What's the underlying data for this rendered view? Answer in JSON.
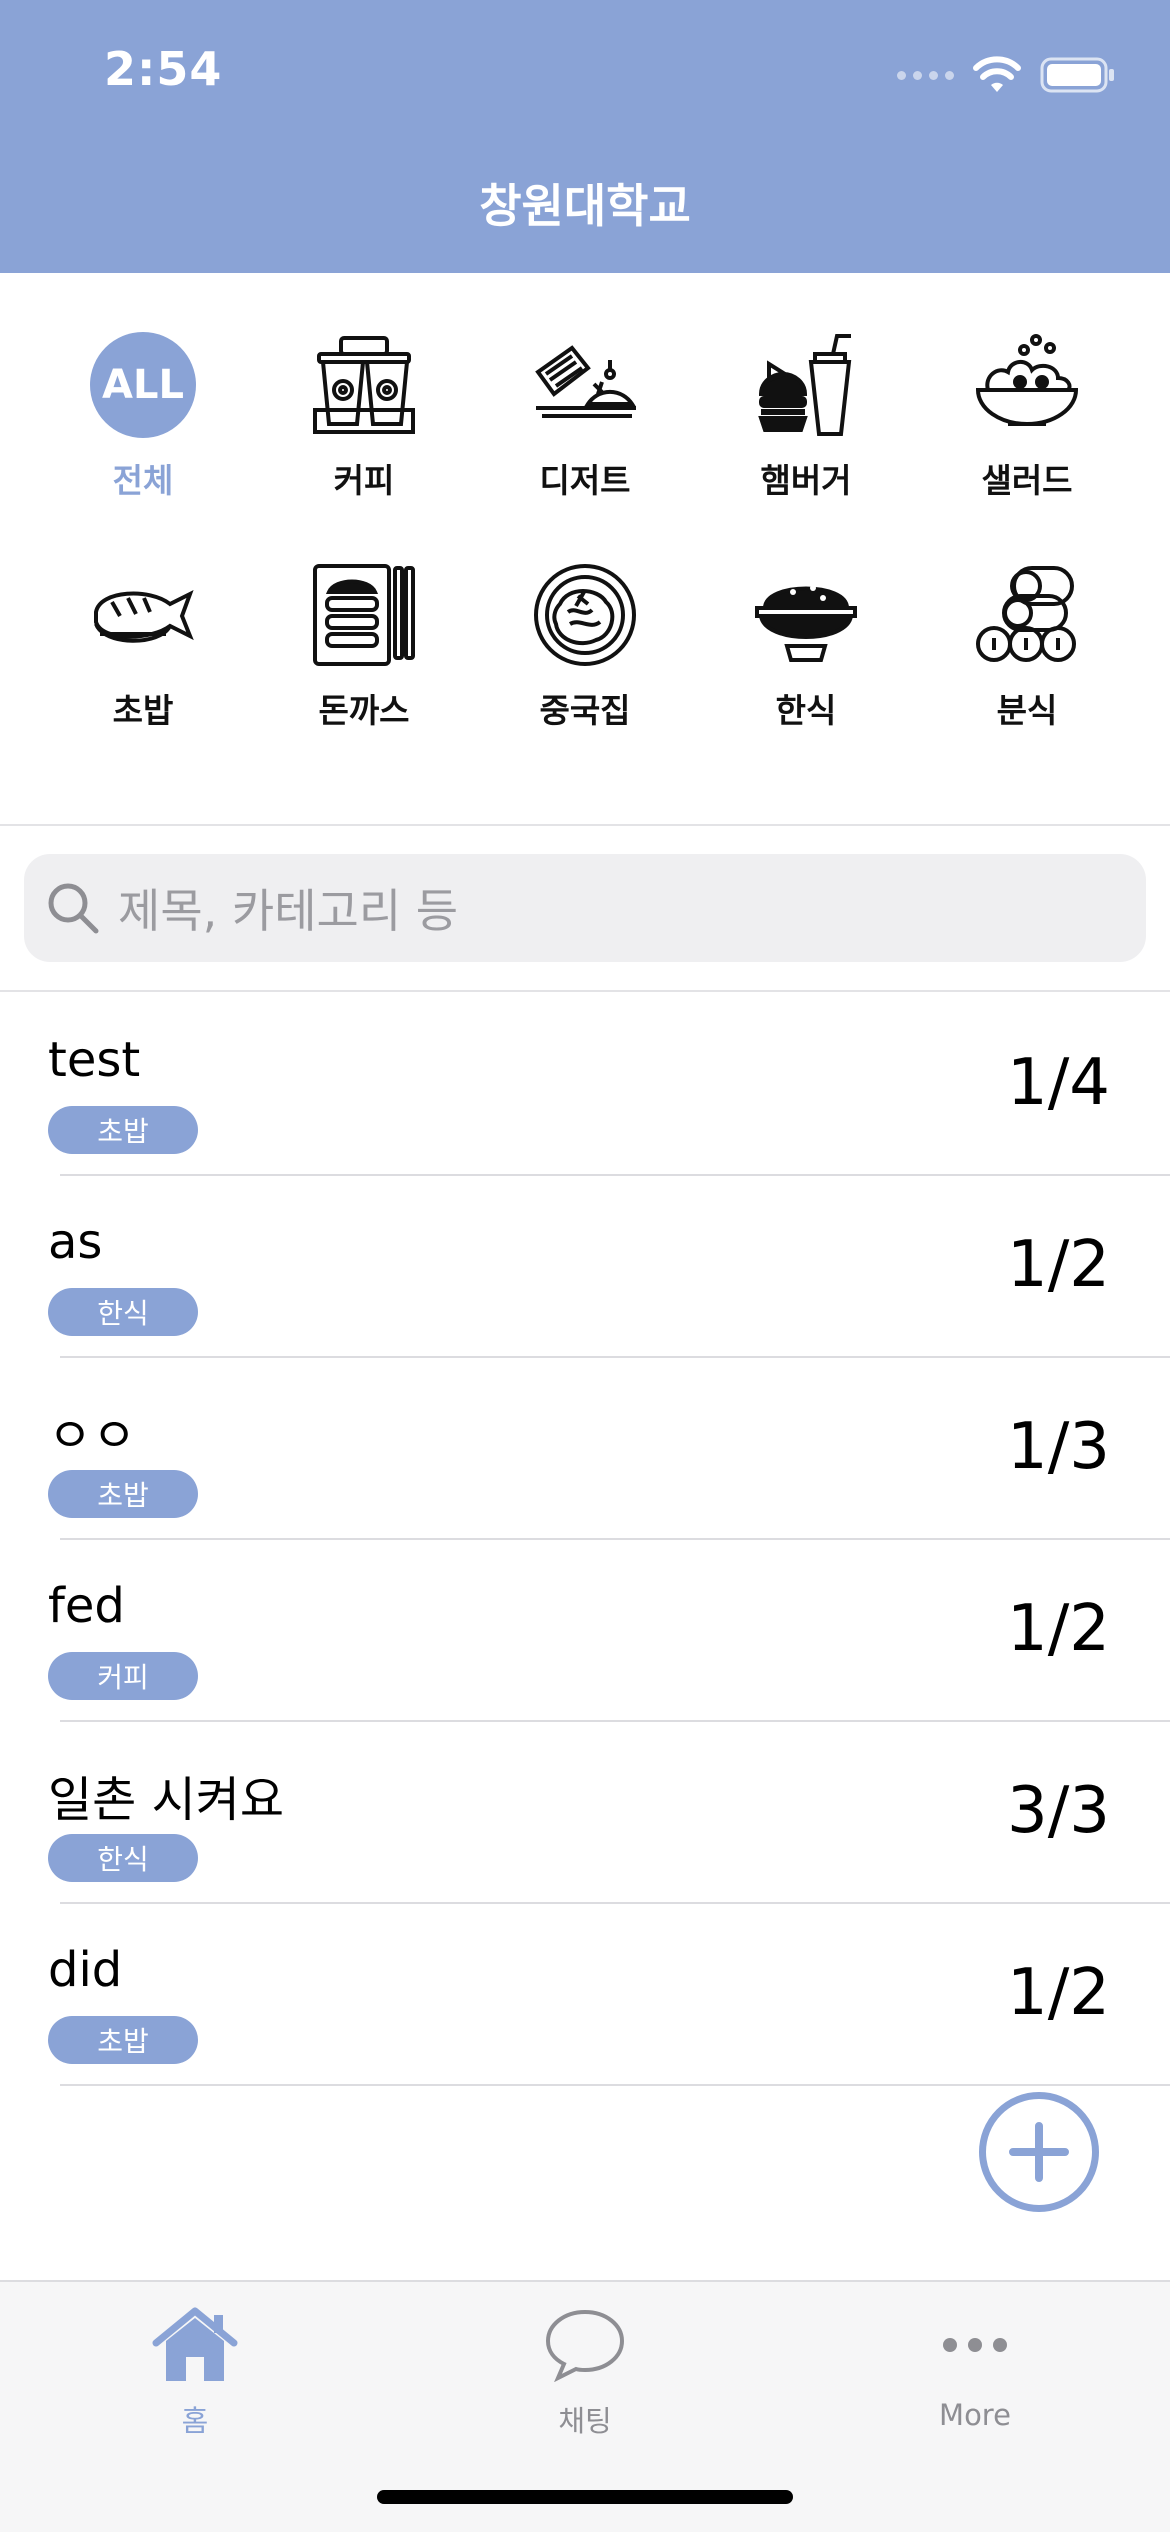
{
  "status_bar": {
    "time": "2:54"
  },
  "nav": {
    "title": "창원대학교"
  },
  "colors": {
    "accent": "#8aa3d6",
    "header": "#8aa3d6",
    "tabbar": "#f6f6f7"
  },
  "categories": [
    {
      "label": "전체",
      "icon": "all-icon",
      "badge": "ALL",
      "active": true
    },
    {
      "label": "커피",
      "icon": "coffee-icon"
    },
    {
      "label": "디저트",
      "icon": "dessert-icon"
    },
    {
      "label": "햄버거",
      "icon": "burger-icon"
    },
    {
      "label": "샐러드",
      "icon": "salad-icon"
    },
    {
      "label": "초밥",
      "icon": "sushi-icon"
    },
    {
      "label": "돈까스",
      "icon": "cutlet-icon"
    },
    {
      "label": "중국집",
      "icon": "chinese-food-icon"
    },
    {
      "label": "한식",
      "icon": "rice-bowl-icon"
    },
    {
      "label": "분식",
      "icon": "kimbap-icon"
    }
  ],
  "search": {
    "placeholder": "제목, 카테고리 등"
  },
  "posts": [
    {
      "title": "test",
      "category": "초밥",
      "count": "1/4"
    },
    {
      "title": "as",
      "category": "한식",
      "count": "1/2"
    },
    {
      "title": "ㅇㅇ",
      "category": "초밥",
      "count": "1/3"
    },
    {
      "title": "fed",
      "category": "커피",
      "count": "1/2"
    },
    {
      "title": "일촌 시켜요",
      "category": "한식",
      "count": "3/3"
    },
    {
      "title": "did",
      "category": "초밥",
      "count": "1/2"
    }
  ],
  "tabbar": {
    "items": [
      {
        "label": "홈",
        "icon": "home-icon",
        "active": true
      },
      {
        "label": "채팅",
        "icon": "chat-bubble-icon"
      },
      {
        "label": "More",
        "icon": "more-dots-icon"
      }
    ]
  }
}
